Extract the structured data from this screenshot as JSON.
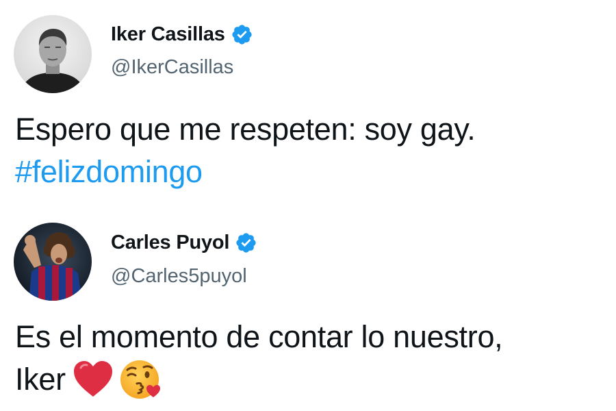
{
  "tweets": [
    {
      "display_name": "Iker Casillas",
      "handle": "@IkerCasillas",
      "verified": true,
      "text_line_1": "Espero que me respeten: soy gay.",
      "hashtag": "#felizdomingo",
      "avatar_icon": "profile-photo-grayscale"
    },
    {
      "display_name": "Carles Puyol",
      "handle": "@Carles5puyol",
      "verified": true,
      "text_line_1": "Es el momento de contar lo nuestro,",
      "text_line_2": "Iker",
      "emojis": [
        "red-heart-icon",
        "face-blowing-kiss-icon"
      ],
      "avatar_icon": "profile-photo-color"
    }
  ],
  "colors": {
    "text": "#0f1419",
    "secondary": "#536471",
    "link": "#1d9bf0",
    "verified": "#1d9bf0"
  }
}
